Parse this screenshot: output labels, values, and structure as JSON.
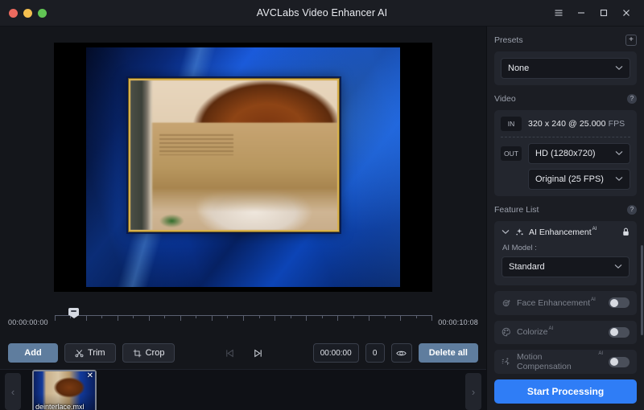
{
  "window": {
    "title": "AVCLabs Video Enhancer AI",
    "traffic_lights": [
      "close-red",
      "minimize-yellow",
      "maximize-green"
    ],
    "controls": [
      {
        "name": "menu-icon",
        "glyph": "☰"
      },
      {
        "name": "minimize-icon",
        "glyph": "−"
      },
      {
        "name": "maximize-icon",
        "glyph": "□"
      },
      {
        "name": "close-icon",
        "glyph": "✕"
      }
    ]
  },
  "preview": {
    "description": "blurred video frame: person holding brown object over face, blue satin background, gold picture frame"
  },
  "timeline": {
    "start_time": "00:00:00:00",
    "end_time": "00:00:10:08",
    "playhead_position_pct": 5,
    "tick_count": 24
  },
  "toolbar": {
    "add_label": "Add",
    "trim_label": "Trim",
    "crop_label": "Crop",
    "trim_icon": "scissors-icon",
    "crop_icon": "crop-icon",
    "prev_frame_icon": "skip-previous-icon",
    "next_frame_icon": "skip-next-icon",
    "time_value": "00:00:00",
    "count_value": "0",
    "preview_toggle_icon": "eye-icon",
    "delete_all_label": "Delete all"
  },
  "filmstrip": {
    "prev_arrow": "‹",
    "next_arrow": "›",
    "clips": [
      {
        "filename": "deinterlace.mxl",
        "remove_glyph": "✕"
      }
    ]
  },
  "sidebar": {
    "presets": {
      "title": "Presets",
      "add_glyph": "+",
      "selected": "None",
      "chevron": "∨"
    },
    "video": {
      "title": "Video",
      "help_glyph": "?",
      "in_tag": "IN",
      "in_value": "320 x 240 @ 25.000",
      "in_unit": "FPS",
      "out_tag": "OUT",
      "out_resolution": "HD (1280x720)",
      "out_framerate": "Original (25 FPS)",
      "chevron": "∨"
    },
    "feature_list": {
      "title": "Feature List",
      "help_glyph": "?",
      "ai_enhancement": {
        "label": "AI Enhancement",
        "superscript": "AI",
        "icon": "sparkle-icon",
        "lock_icon": "lock-icon",
        "expand_chevron": "∨",
        "model_label": "AI Model :",
        "model_value": "Standard",
        "model_chevron": "∨"
      },
      "toggles": [
        {
          "label": "Face Enhancement",
          "superscript": "AI",
          "icon": "face-icon",
          "enabled": false
        },
        {
          "label": "Colorize",
          "superscript": "AI",
          "icon": "palette-icon",
          "enabled": false
        },
        {
          "label": "Motion Compensation",
          "superscript": "AI",
          "icon": "motion-icon",
          "enabled": false
        }
      ]
    },
    "start_button": "Start Processing"
  },
  "colors": {
    "accent_blue": "#2f7df6",
    "button_steel": "#5f7d9e",
    "panel_bg": "#1b1d23",
    "app_bg": "#14161b",
    "card_bg": "#23262e"
  }
}
